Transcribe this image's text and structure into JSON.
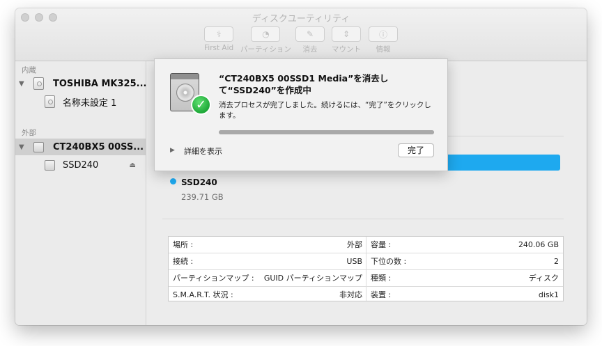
{
  "window": {
    "title": "ディスクユーティリティ"
  },
  "toolbar": {
    "first_aid": "First Aid",
    "partition": "パーティション",
    "erase": "消去",
    "mount": "マウント",
    "info": "情報"
  },
  "sidebar": {
    "internal_label": "内蔵",
    "external_label": "外部",
    "items": [
      {
        "label": "TOSHIBA MK325..."
      },
      {
        "label": "名称未設定 1"
      },
      {
        "label": "CT240BX5 00SS..."
      },
      {
        "label": "SSD240"
      }
    ]
  },
  "volume": {
    "name": "SSD240",
    "size": "239.71 GB",
    "color": "#1ea9ef"
  },
  "info_table": {
    "left": [
      {
        "key": "場所 :",
        "value": "外部"
      },
      {
        "key": "接続 :",
        "value": "USB"
      },
      {
        "key": "パーティションマップ :",
        "value": "GUID パーティションマップ"
      },
      {
        "key": "S.M.A.R.T. 状況 :",
        "value": "非対応"
      }
    ],
    "right": [
      {
        "key": "容量 :",
        "value": "240.06 GB"
      },
      {
        "key": "下位の数 :",
        "value": "2"
      },
      {
        "key": "種類 :",
        "value": "ディスク"
      },
      {
        "key": "装置 :",
        "value": "disk1"
      }
    ]
  },
  "sheet": {
    "title": "“CT240BX5 00SSD1 Media”を消去して“SSD240”を作成中",
    "message": "消去プロセスが完了しました。続けるには、“完了”をクリックします。",
    "progress": 1.0,
    "show_details": "詳細を表示",
    "done_button": "完了"
  }
}
